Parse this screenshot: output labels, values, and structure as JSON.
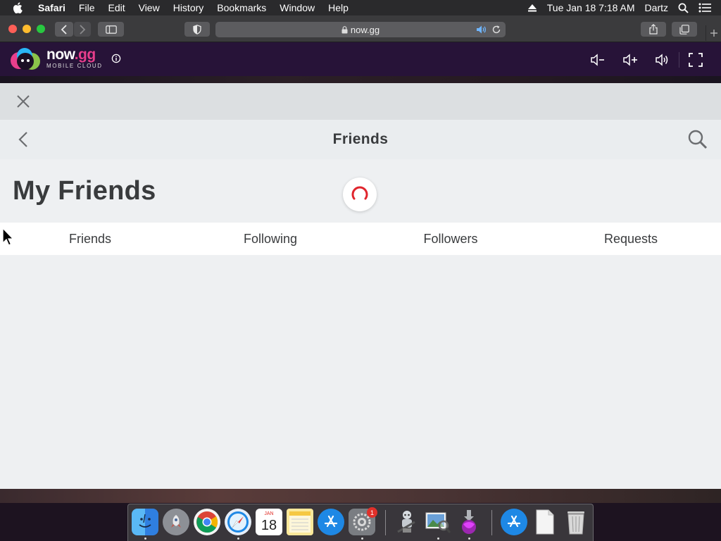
{
  "menubar": {
    "items": [
      "Safari",
      "File",
      "Edit",
      "View",
      "History",
      "Bookmarks",
      "Window",
      "Help"
    ],
    "datetime": "Tue Jan 18  7:18 AM",
    "user": "Dartz"
  },
  "browser": {
    "url": "now.gg"
  },
  "nowgg": {
    "brand_name": "now",
    "brand_tld": ".gg",
    "brand_sub": "MOBILE CLOUD"
  },
  "app": {
    "nav_title": "Friends",
    "page_title": "My Friends",
    "tabs": [
      "Friends",
      "Following",
      "Followers",
      "Requests"
    ],
    "loading": true
  },
  "dock": {
    "calendar_month": "JAN",
    "calendar_day": "18",
    "settings_badge": "1"
  },
  "colors": {
    "accent": "#e0252d",
    "header_bg": "#271338",
    "text": "#393b3d"
  }
}
